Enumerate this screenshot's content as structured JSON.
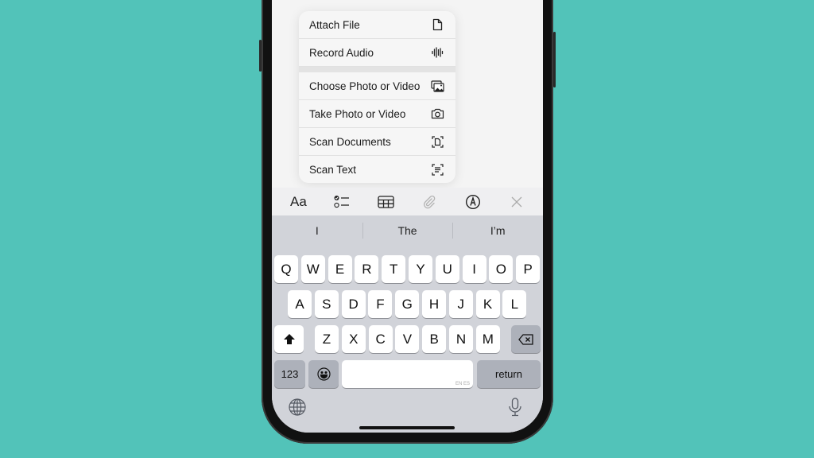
{
  "menu": {
    "items": [
      {
        "label": "Attach File",
        "icon": "document-icon"
      },
      {
        "label": "Record Audio",
        "icon": "waveform-icon"
      },
      {
        "label": "Choose Photo or Video",
        "icon": "photo-library-icon"
      },
      {
        "label": "Take Photo or Video",
        "icon": "camera-icon"
      },
      {
        "label": "Scan Documents",
        "icon": "scan-document-icon"
      },
      {
        "label": "Scan Text",
        "icon": "scan-text-icon"
      }
    ]
  },
  "toolbar": {
    "format_label": "Aa",
    "items": [
      "format-icon",
      "checklist-icon",
      "table-icon",
      "paperclip-icon",
      "markup-icon",
      "close-icon"
    ]
  },
  "keyboard": {
    "suggestions": [
      "I",
      "The",
      "I’m"
    ],
    "row1": [
      "Q",
      "W",
      "E",
      "R",
      "T",
      "Y",
      "U",
      "I",
      "O",
      "P"
    ],
    "row2": [
      "A",
      "S",
      "D",
      "F",
      "G",
      "H",
      "J",
      "K",
      "L"
    ],
    "row3": [
      "Z",
      "X",
      "C",
      "V",
      "B",
      "N",
      "M"
    ],
    "numbers_label": "123",
    "return_label": "return",
    "space_hint": "EN ES"
  },
  "colors": {
    "background": "#52c3b9",
    "keyboard": "#d1d3d9",
    "key": "#ffffff",
    "key_dark": "#adb1ba"
  }
}
